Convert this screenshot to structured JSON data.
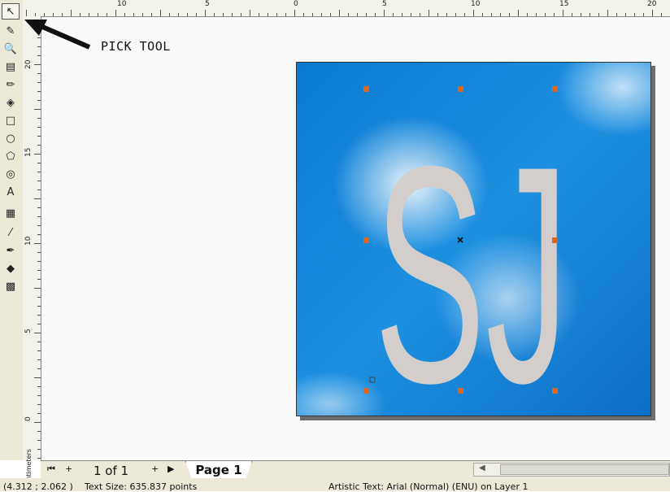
{
  "annotation": {
    "label": "PICK TOOL"
  },
  "tools": [
    {
      "name": "pick-tool",
      "glyph": "↖",
      "active": true
    },
    {
      "name": "shape-tool",
      "glyph": "✎",
      "active": false
    },
    {
      "name": "zoom-tool",
      "glyph": "🔍",
      "active": false
    },
    {
      "name": "dimension-tool",
      "glyph": "▤",
      "active": false
    },
    {
      "name": "freehand-tool",
      "glyph": "✏",
      "active": false
    },
    {
      "name": "smart-fill-tool",
      "glyph": "◈",
      "active": false
    },
    {
      "name": "rectangle-tool",
      "glyph": "□",
      "active": false
    },
    {
      "name": "ellipse-tool",
      "glyph": "○",
      "active": false
    },
    {
      "name": "polygon-tool",
      "glyph": "⬠",
      "active": false
    },
    {
      "name": "basic-shapes-tool",
      "glyph": "◎",
      "active": false
    },
    {
      "name": "text-tool",
      "glyph": "A",
      "active": false
    },
    {
      "name": "interactive-blend-tool",
      "glyph": "▦",
      "active": false
    },
    {
      "name": "eyedropper-tool",
      "glyph": "⁄",
      "active": false
    },
    {
      "name": "outline-tool",
      "glyph": "✒",
      "active": false
    },
    {
      "name": "fill-tool",
      "glyph": "◆",
      "active": false
    },
    {
      "name": "interactive-fill-tool",
      "glyph": "▩",
      "active": false
    }
  ],
  "ruler": {
    "horizontal": [
      "10",
      "5",
      "0",
      "5",
      "10",
      "15",
      "20"
    ],
    "vertical": [
      "20",
      "15",
      "10",
      "5",
      "0"
    ],
    "unit": "centimeters"
  },
  "artwork": {
    "text": "SJ"
  },
  "pagination": {
    "count_label": "1 of 1",
    "tab_label": "Page 1",
    "first_icon": "⏮",
    "add_icon": "+",
    "next_icon": "▶"
  },
  "status": {
    "coords": "(4.312 ; 2.062 )",
    "text_size": "Text Size: 635.837 points",
    "object_info": "Artistic Text: Arial (Normal) (ENU) on Layer 1"
  },
  "colors": {
    "page_blue": "#1a86d6",
    "letter_fill": "#d3cecb",
    "handle": "#e0661e"
  }
}
